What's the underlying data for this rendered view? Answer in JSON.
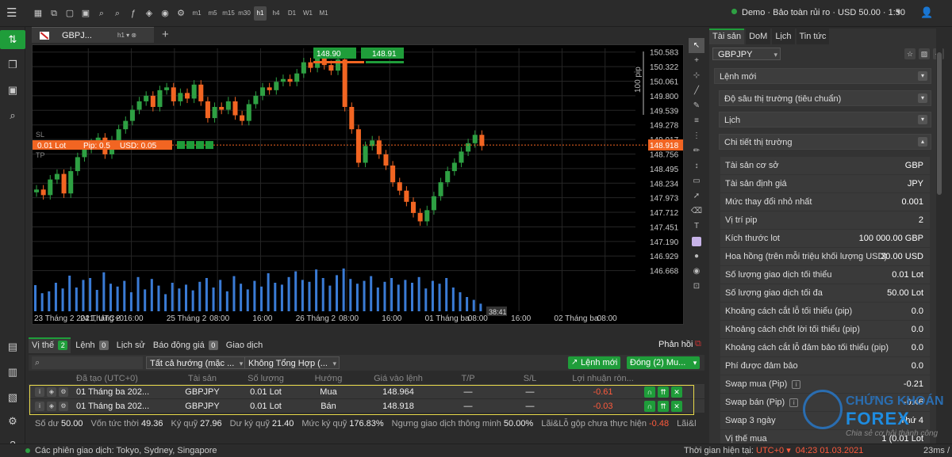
{
  "topbar": {
    "menu_icon": "hamburger-icon",
    "timeframes": [
      "m1",
      "m5",
      "m15",
      "m30",
      "h1",
      "h4",
      "D1",
      "W1",
      "M1"
    ],
    "active_timeframe": "h1",
    "account": "Demo · Bảo toàn rủi ro · USD 50.00 · 1:50"
  },
  "chart_tab": {
    "symbol": "GBPJ...",
    "timeframe": "h1 ▾  ⊗",
    "add": "+"
  },
  "chart_data": {
    "type": "candlestick",
    "symbol": "GBPJPY",
    "price_ticks": [
      "150.583",
      "150.322",
      "150.061",
      "149.800",
      "149.539",
      "149.278",
      "149.017",
      "148.756",
      "148.495",
      "148.234",
      "147.973",
      "147.712",
      "147.451",
      "147.190",
      "146.929",
      "146.668"
    ],
    "ylim": [
      146.45,
      150.65
    ],
    "time_ticks": [
      "23 Tháng 2 2021, UTC+0",
      "24 Tháng 2",
      "16:00",
      "25 Tháng 2",
      "08:00",
      "16:00",
      "26 Tháng 2",
      "08:00",
      "16:00",
      "01 Tháng ba",
      "08:00",
      "16:00",
      "02 Tháng ba",
      "08:00"
    ],
    "current_price": "148.918",
    "bid_label": "148.90",
    "ask_label": "148.91",
    "cursor_time_label": "38:41",
    "pip_scale_label": "100 pip",
    "position_bar": {
      "lot": "0.01 Lot",
      "pip": "Pip: 0.5",
      "usd": "USD: 0.05"
    },
    "sl_label": "SL",
    "tp_label": "TP",
    "closes": [
      148.12,
      148.02,
      148.3,
      148.4,
      148.05,
      148.45,
      148.7,
      148.85,
      148.95,
      149.05,
      148.75,
      149.0,
      149.2,
      149.35,
      149.55,
      149.7,
      149.8,
      149.6,
      149.9,
      149.95,
      149.7,
      149.85,
      149.75,
      150.0,
      149.7,
      149.4,
      149.6,
      149.55,
      149.7,
      149.45,
      149.35,
      149.65,
      149.8,
      149.95,
      149.9,
      150.05,
      150.1,
      150.05,
      150.2,
      150.4,
      150.3,
      150.55,
      150.35,
      150.25,
      150.45,
      149.6,
      149.2,
      148.6,
      148.9,
      149.0,
      148.75,
      148.55,
      148.25,
      148.1,
      147.9,
      147.7,
      147.55,
      147.75,
      148.0,
      148.25,
      148.45,
      148.6,
      148.8,
      148.95,
      149.1,
      148.9
    ],
    "volumes": [
      0.55,
      0.38,
      0.42,
      0.6,
      0.48,
      0.75,
      0.5,
      0.66,
      0.7,
      0.45,
      0.82,
      0.58,
      0.52,
      0.64,
      0.4,
      0.72,
      0.46,
      0.68,
      0.54,
      0.36,
      0.6,
      0.48,
      0.56,
      0.44,
      0.62,
      0.7,
      0.5,
      0.66,
      0.42,
      0.74,
      0.58,
      0.46,
      0.64,
      0.52,
      0.8,
      0.6,
      0.56,
      0.72,
      0.84,
      0.66,
      0.62,
      0.88,
      0.7,
      0.54,
      0.76,
      0.9,
      0.68,
      0.58,
      0.64,
      0.74,
      0.5,
      0.62,
      0.7,
      0.56,
      0.66,
      0.6,
      0.72,
      0.48,
      0.64,
      0.58,
      0.7,
      0.5,
      0.4,
      0.3,
      0.24,
      0.16
    ]
  },
  "tools": [
    "cursor-icon",
    "crosshair-icon",
    "crosshair-plus-icon",
    "line-icon",
    "pen-icon",
    "text-line-icon",
    "fib-icon",
    "pencil-icon",
    "measure-icon",
    "rectangle-icon",
    "arrow-icon",
    "eraser-icon",
    "text-icon",
    "color-swatch",
    "circle-icon",
    "eye-icon",
    "lock-icon"
  ],
  "bottom": {
    "tabs": [
      {
        "label": "Vị thế",
        "count": "2"
      },
      {
        "label": "Lệnh",
        "count": "0"
      },
      {
        "label": "Lịch sử",
        "count": ""
      },
      {
        "label": "Báo động giá",
        "count": "0"
      },
      {
        "label": "Giao dịch",
        "count": ""
      }
    ],
    "feedback": "Phản hồi",
    "filter_direction": "Tất cả hướng (mặc ...",
    "filter_aggregate": "Không Tổng Hợp (...",
    "new_order": "Lệnh mới",
    "close_btn": "Đóng (2) Mu...",
    "columns": [
      "Đã tạo (UTC+0)",
      "Tài sản",
      "Số lượng",
      "Hướng",
      "Giá vào lệnh",
      "T/P",
      "S/L",
      "Lợi nhuận ròn..."
    ],
    "rows": [
      {
        "time": "01 Tháng ba 202...",
        "symbol": "GBPJPY",
        "qty": "0.01 Lot",
        "side": "Mua",
        "price": "148.964",
        "tp": "—",
        "sl": "—",
        "pl": "-0.61"
      },
      {
        "time": "01 Tháng ba 202...",
        "symbol": "GBPJPY",
        "qty": "0.01 Lot",
        "side": "Bán",
        "price": "148.918",
        "tp": "—",
        "sl": "—",
        "pl": "-0.03"
      }
    ],
    "summary": [
      {
        "label": "Số dư",
        "value": "50.00",
        "neg": false
      },
      {
        "label": "Vốn tức thời",
        "value": "49.36",
        "neg": false
      },
      {
        "label": "Ký quỹ",
        "value": "27.96",
        "neg": false
      },
      {
        "label": "Dư ký quỹ",
        "value": "21.40",
        "neg": false
      },
      {
        "label": "Mức ký quỹ",
        "value": "176.83%",
        "neg": false
      },
      {
        "label": "Ngưng giao dịch thông minh",
        "value": "50.00%",
        "neg": false
      },
      {
        "label": "Lãi&Lỗ gộp chưa thực hiện",
        "value": "-0.48",
        "neg": true
      },
      {
        "label": "Lãi&l",
        "value": "",
        "neg": false
      }
    ]
  },
  "right": {
    "tabs": [
      "Tài sản",
      "DoM",
      "Lịch",
      "Tin tức"
    ],
    "symbol": "GBPJPY",
    "sections": [
      "Lệnh mới",
      "Độ sâu thị trường (tiêu chuẩn)",
      "Lịch",
      "Chi tiết thị trường"
    ],
    "details": [
      {
        "label": "Tài sản cơ sở",
        "value": "GBP",
        "info": false
      },
      {
        "label": "Tài sản định giá",
        "value": "JPY",
        "info": false
      },
      {
        "label": "Mức thay đổi nhỏ nhất",
        "value": "0.001",
        "info": false
      },
      {
        "label": "Vị trí pip",
        "value": "2",
        "info": false
      },
      {
        "label": "Kích thước lot",
        "value": "100 000.00 GBP",
        "info": false
      },
      {
        "label": "Hoa hồng (trên mỗi triệu khối lượng USD)",
        "value": "30.00 USD",
        "info": false
      },
      {
        "label": "Số lượng giao dịch tối thiểu",
        "value": "0.01 Lot",
        "info": false
      },
      {
        "label": "Số lượng giao dịch tối đa",
        "value": "50.00 Lot",
        "info": false
      },
      {
        "label": "Khoảng cách cắt lỗ tối thiểu (pip)",
        "value": "0.0",
        "info": false
      },
      {
        "label": "Khoảng cách chốt lời tối thiểu (pip)",
        "value": "0.0",
        "info": false
      },
      {
        "label": "Khoảng cách cắt lỗ đảm bảo tối thiểu (pip)",
        "value": "0.0",
        "info": false
      },
      {
        "label": "Phí được đảm bảo",
        "value": "0.0",
        "info": false
      },
      {
        "label": "Swap mua (Pip)",
        "value": "-0.21",
        "info": true
      },
      {
        "label": "Swap bán (Pip)",
        "value": "-0.46",
        "info": true
      },
      {
        "label": "Swap 3 ngày",
        "value": "Thứ 4",
        "info": false
      },
      {
        "label": "Vị thế mua",
        "value": "1 (0.01 Lot",
        "info": false
      }
    ]
  },
  "watermark": {
    "line1": "CHỨNG KHOÁN",
    "line2": "FOREX",
    "line3": "Chia sẻ cơ hội thành công",
    "site": ".com"
  },
  "status": {
    "sessions": "Các phiên giao dịch: Tokyo, Sydney, Singapore",
    "server_time_label": "Thời gian hiện tại:",
    "tz": "UTC+0 ▾",
    "time": "04:23 01.03.2021",
    "ping": "23ms / 23ms"
  },
  "colors": {
    "bull": "#2ea043",
    "bear": "#f26522",
    "volume": "#3a7bd5",
    "accent": "#1f9d3a"
  }
}
